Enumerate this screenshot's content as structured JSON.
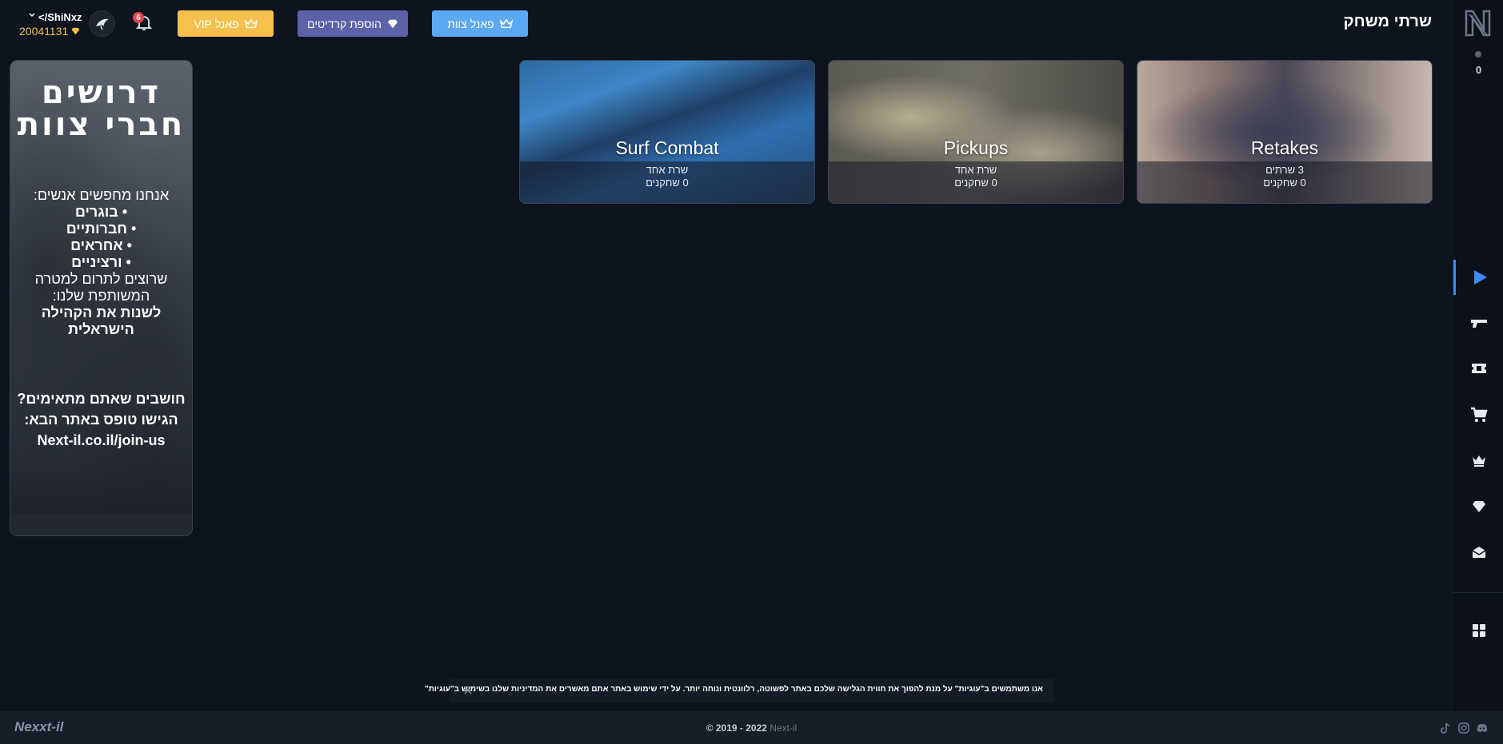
{
  "header": {
    "page_title": "שרתי משחק",
    "team_panel_label": "פאנל צוות",
    "add_credits_label": "הוספת קרדיטים",
    "vip_panel_label": "פאנל VIP",
    "notifications_count": "6",
    "username": "</ShiNxz",
    "credits": "20041131"
  },
  "sidebar": {
    "online_count": "0",
    "items": [
      {
        "icon": "play-icon",
        "active": true
      },
      {
        "icon": "gun-icon"
      },
      {
        "icon": "ticket-icon"
      },
      {
        "icon": "cart-icon"
      },
      {
        "icon": "crown-icon"
      },
      {
        "icon": "diamond-icon"
      },
      {
        "icon": "mail-icon"
      },
      {
        "icon": "grid-icon"
      }
    ]
  },
  "banner": {
    "title_line1": "דרושים",
    "title_line2": "חברי צוות",
    "intro": "אנחנו מחפשים אנשים:",
    "bullets": [
      "• בוגרים",
      "• חברותיים",
      "• אחראים",
      "• ורציניים"
    ],
    "line_contribute": "שרוצים לתרום למטרה",
    "line_shared": "המשותפת שלנו:",
    "line_change": "לשנות את הקהילה",
    "line_israeli": "הישראלית",
    "cta_question": "חושבים שאתם מתאימים?",
    "cta_apply": "הגישו טופס באתר הבא:",
    "cta_url": "Next-il.co.il/join-us"
  },
  "modes": [
    {
      "name": "Retakes",
      "servers": "3 שרתים",
      "players": "0 שחקנים"
    },
    {
      "name": "Pickups",
      "servers": "שרת אחד",
      "players": "0 שחקנים"
    },
    {
      "name": "Surf Combat",
      "servers": "שרת אחד",
      "players": "0 שחקנים"
    }
  ],
  "cookie_notice": "אנו משתמשים ב\"עוגיות\" על מנת להפוך את חווית הגלישה שלכם באתר לפשוטה, רלוונטית ונוחה יותר. על ידי שימוש באתר אתם מאשרים את המדיניות שלנו בשימוש ב\"עוגיות\"",
  "footer": {
    "logo_text": "Nexxt-il",
    "copyright": "© 2019 - 2022",
    "brand": "Next-il"
  },
  "colors": {
    "background": "#0e1320",
    "accent_blue": "#5aa9f2",
    "accent_purple": "#5b62a8",
    "accent_gold": "#f5c04c",
    "active_indicator": "#3b8cf7"
  }
}
